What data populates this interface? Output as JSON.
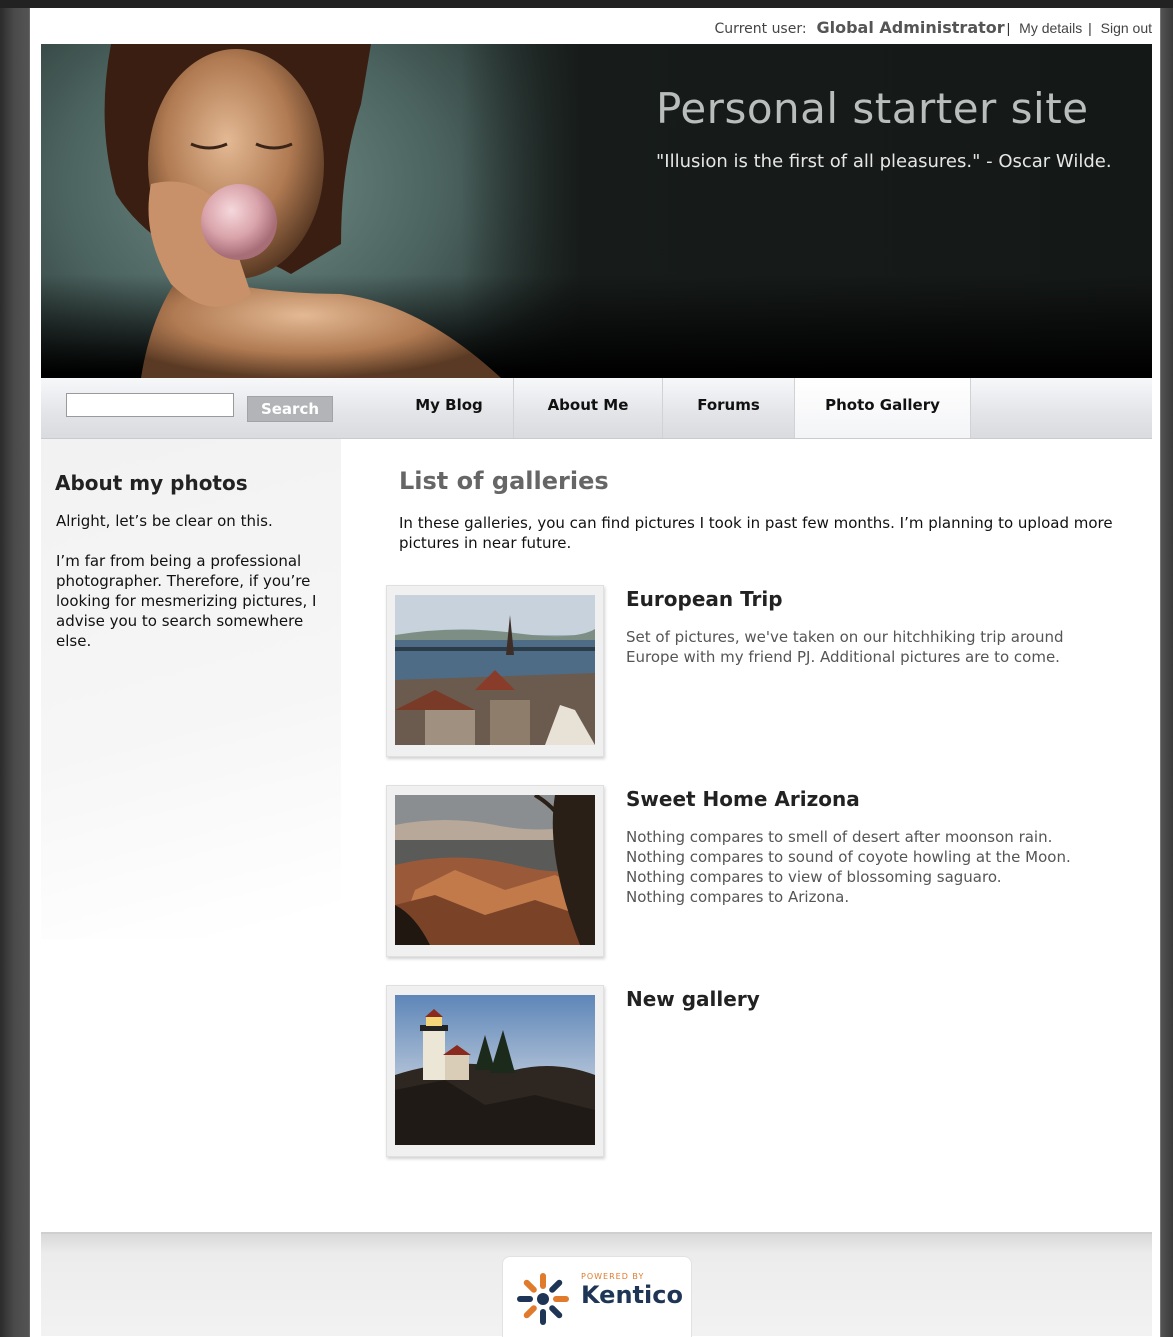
{
  "userbar": {
    "current_user_label": "Current user:",
    "user_name": "Global Administrator",
    "my_details": "My details",
    "sign_out": "Sign out"
  },
  "header": {
    "title": "Personal starter site",
    "quote": "\"Illusion is the first of all pleasures.\" - Oscar Wilde."
  },
  "search": {
    "value": "",
    "button_label": "Search"
  },
  "nav": {
    "items": [
      {
        "label": "My Blog"
      },
      {
        "label": "About Me"
      },
      {
        "label": "Forums"
      },
      {
        "label": "Photo Gallery"
      }
    ],
    "active": "Photo Gallery"
  },
  "sidebar": {
    "title": "About my photos",
    "p1": "Alright, let’s be clear on this.",
    "p2": "I’m far from being a professional photographer. Therefore, if you’re looking for mesmerizing pictures, I advise you to search somewhere else."
  },
  "main": {
    "title": "List of galleries",
    "intro": "In these galleries, you can find pictures I took in past few months. I’m planning to upload more pictures in near future.",
    "galleries": [
      {
        "title": "European Trip",
        "desc": [
          "Set of pictures, we've taken on our hitchhiking trip around",
          "Europe with my friend PJ. Additional pictures are to come."
        ],
        "thumb_icon": "city-photo"
      },
      {
        "title": "Sweet Home Arizona",
        "desc": [
          "Nothing compares to smell of desert after moonson rain.",
          "Nothing compares to sound of coyote howling at the Moon.",
          "Nothing compares to view of blossoming saguaro.",
          "Nothing compares to Arizona."
        ],
        "thumb_icon": "canyon-photo"
      },
      {
        "title": "New gallery",
        "desc": [],
        "thumb_icon": "lighthouse-photo"
      }
    ]
  },
  "footer": {
    "powered_by": "POWERED BY",
    "brand": "Kentico"
  },
  "colors": {
    "accent_orange": "#e07a2c",
    "brand_navy": "#1f3556"
  }
}
